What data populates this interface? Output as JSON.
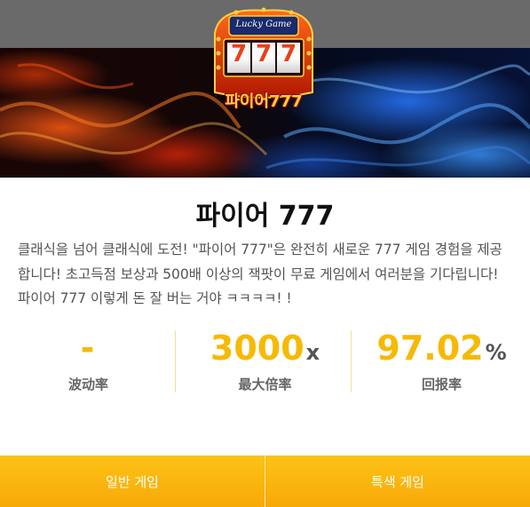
{
  "logo": {
    "lucky_text": "Lucky Game",
    "brand_text": "파이어777",
    "reels": [
      "7",
      "7",
      "7"
    ]
  },
  "title": "파이어 777",
  "description": "클래식을 넘어 클래식에 도전!  \"파이어 777\"은 완전히 새로운 777 게임 경험을 제공합니다! 초고득점 보상과 500배 이상의 잭팟이 무료 게임에서 여러분을 기다립니다! 파이어 777 이렇게 돈 잘 버는 거야 ㅋㅋㅋㅋ! !",
  "stats": [
    {
      "value": "-",
      "unit": "",
      "label": "波动率"
    },
    {
      "value": "3000",
      "unit": "x",
      "label": "最大倍率"
    },
    {
      "value": "97.02",
      "unit": "%",
      "label": "回报率"
    }
  ],
  "buttons": {
    "normal_game": "일반 게임",
    "special_game": "특색 게임"
  },
  "colors": {
    "accent": "#f6b904",
    "button_bg": "#fbb710",
    "divider": "#f3dfa4",
    "top_bar": "#6a6a6a"
  }
}
